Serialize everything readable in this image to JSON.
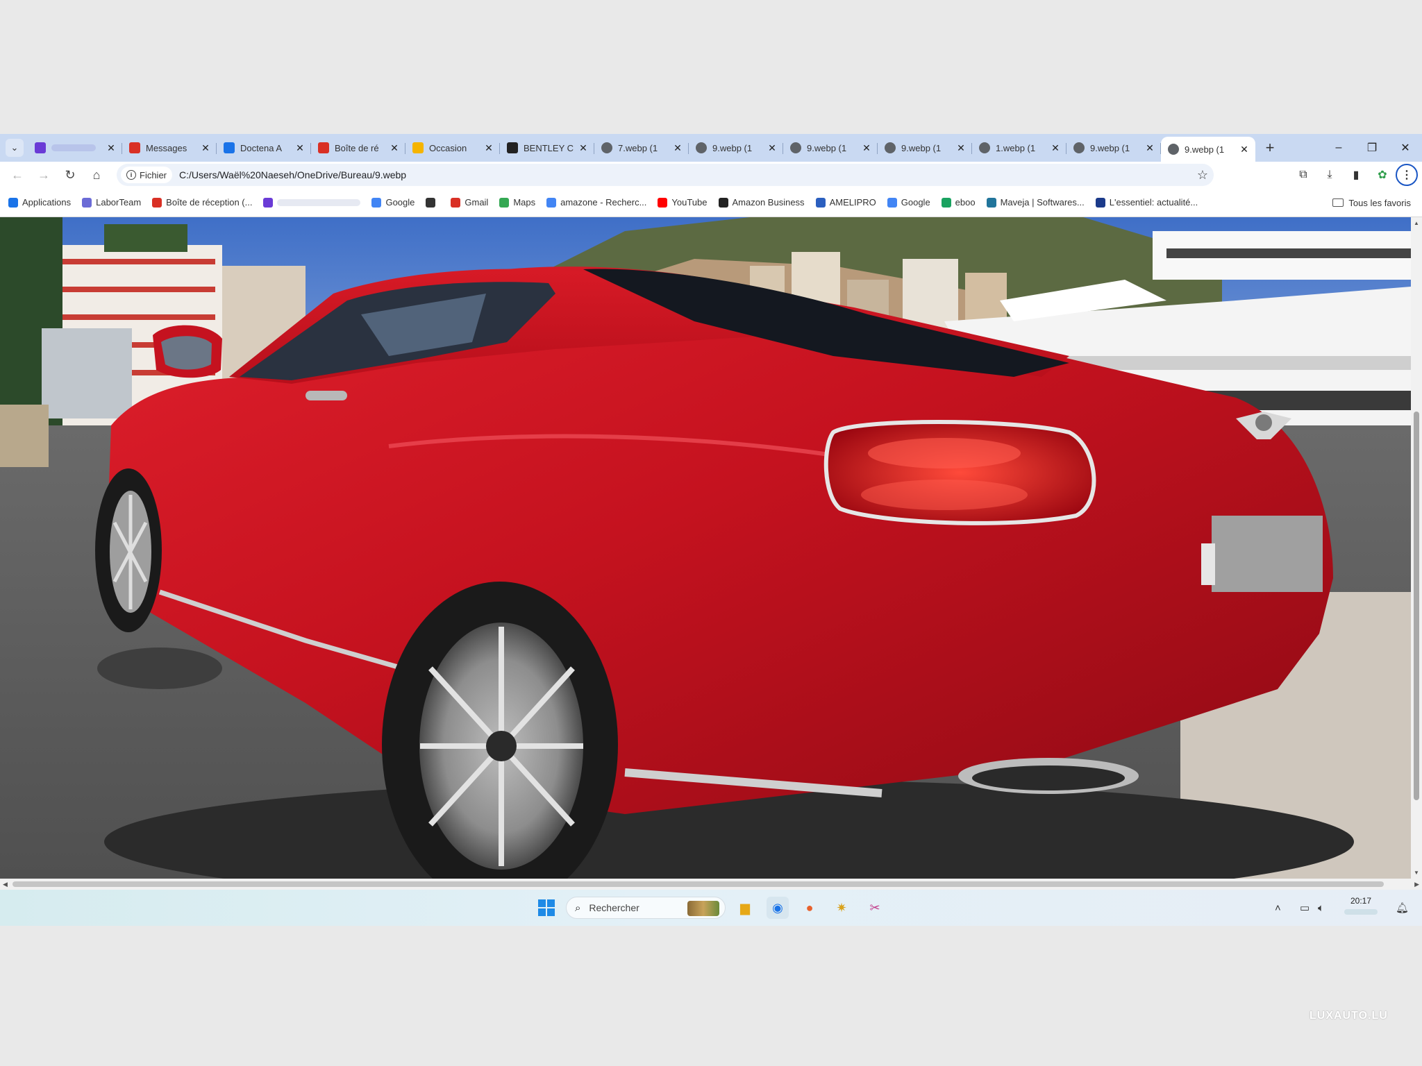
{
  "browser": {
    "tabs": [
      {
        "title": "",
        "favicon": "mail-icon",
        "color": "#6a3bd6",
        "blurred": true
      },
      {
        "title": "Messages",
        "favicon": "gmail-icon",
        "color": "#d93025"
      },
      {
        "title": "Doctena A",
        "favicon": "maps-pin-icon",
        "color": "#1a73e8"
      },
      {
        "title": "Boîte de ré",
        "favicon": "gmail-icon",
        "color": "#d93025"
      },
      {
        "title": "Occasion",
        "favicon": "occasion-icon",
        "color": "#f5b400"
      },
      {
        "title": "BENTLEY C",
        "favicon": "bentley-icon",
        "color": "#222222"
      },
      {
        "title": "7.webp (1",
        "favicon": "globe-icon",
        "color": "#5f6368"
      },
      {
        "title": "9.webp (1",
        "favicon": "globe-icon",
        "color": "#5f6368"
      },
      {
        "title": "9.webp (1",
        "favicon": "globe-icon",
        "color": "#5f6368"
      },
      {
        "title": "9.webp (1",
        "favicon": "globe-icon",
        "color": "#5f6368"
      },
      {
        "title": "1.webp (1",
        "favicon": "globe-icon",
        "color": "#5f6368"
      },
      {
        "title": "9.webp (1",
        "favicon": "globe-icon",
        "color": "#5f6368"
      },
      {
        "title": "9.webp (1",
        "favicon": "globe-icon",
        "color": "#5f6368",
        "active": true
      }
    ],
    "new_tab": "+",
    "window_controls": {
      "minimize": "–",
      "restore": "❐",
      "close": "✕"
    },
    "toolbar": {
      "back": "←",
      "forward": "→",
      "reload": "↻",
      "home": "⌂",
      "chip_label": "Fichier",
      "url": "C:/Users/Waël%20Naeseh/OneDrive/Bureau/9.webp",
      "star": "☆"
    },
    "bookmarks": [
      {
        "label": "Applications",
        "icon": "apps-grid-icon",
        "color": "#1a73e8"
      },
      {
        "label": "LaborTeam",
        "icon": "laborteam-icon",
        "color": "#6b6bd6"
      },
      {
        "label": "Boîte de réception (...",
        "icon": "gmail-icon",
        "color": "#d93025"
      },
      {
        "label": "",
        "icon": "mail-icon",
        "color": "#6a3bd6",
        "blurred": true
      },
      {
        "label": "Google",
        "icon": "google-icon",
        "color": "#4285f4"
      },
      {
        "label": "",
        "icon": "list-icon",
        "color": "#333333"
      },
      {
        "label": "Gmail",
        "icon": "gmail-icon",
        "color": "#d93025"
      },
      {
        "label": "Maps",
        "icon": "maps-pin-icon",
        "color": "#34a853"
      },
      {
        "label": "amazone - Recherc...",
        "icon": "google-icon",
        "color": "#4285f4"
      },
      {
        "label": "YouTube",
        "icon": "youtube-icon",
        "color": "#ff0000"
      },
      {
        "label": "Amazon Business",
        "icon": "amazon-icon",
        "color": "#222222"
      },
      {
        "label": "AMELIPRO",
        "icon": "amelipro-icon",
        "color": "#2b5fbf"
      },
      {
        "label": "Google",
        "icon": "google-icon",
        "color": "#4285f4"
      },
      {
        "label": "eboo",
        "icon": "eboo-icon",
        "color": "#1aa260"
      },
      {
        "label": "Maveja | Softwares...",
        "icon": "wordpress-icon",
        "color": "#21759b"
      },
      {
        "label": "L'essentiel: actualité...",
        "icon": "lessentiel-icon",
        "color": "#1b3a8a"
      }
    ],
    "all_bookmarks": "Tous les favoris"
  },
  "taskbar": {
    "search_placeholder": "Rechercher",
    "time": "20:17",
    "apps": [
      "file-explorer-icon",
      "chrome-icon",
      "firefox-icon",
      "photos-icon",
      "snipping-tool-icon"
    ]
  },
  "watermark": "LUXAUTO.LU"
}
